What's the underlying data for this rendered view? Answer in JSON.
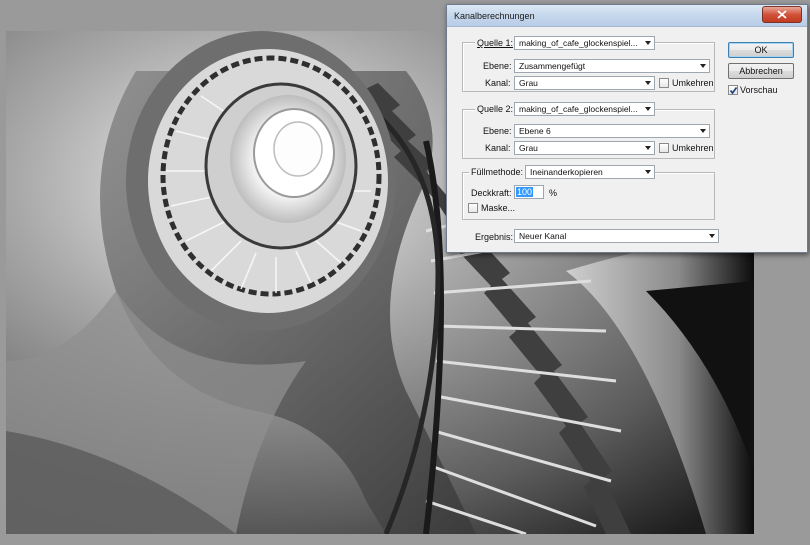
{
  "dialog": {
    "title": "Kanalberechnungen",
    "source1": {
      "label": "Quelle 1:",
      "file": "making_of_cafe_glockenspiel...",
      "layer_label": "Ebene:",
      "layer": "Zusammengefügt",
      "channel_label": "Kanal:",
      "channel": "Grau",
      "invert_label": "Umkehren",
      "invert_checked": false
    },
    "source2": {
      "label": "Quelle 2:",
      "file": "making_of_cafe_glockenspiel...",
      "layer_label": "Ebene:",
      "layer": "Ebene 6",
      "channel_label": "Kanal:",
      "channel": "Grau",
      "invert_label": "Umkehren",
      "invert_checked": false
    },
    "blending": {
      "mode_label": "Füllmethode:",
      "mode": "Ineinanderkopieren",
      "opacity_label": "Deckkraft:",
      "opacity_value": "100",
      "opacity_unit": "%",
      "mask_label": "Maske...",
      "mask_checked": false
    },
    "result": {
      "label": "Ergebnis:",
      "value": "Neuer Kanal"
    },
    "buttons": {
      "ok": "OK",
      "cancel": "Abbrechen"
    },
    "preview": {
      "label": "Vorschau",
      "checked": true
    }
  },
  "colors": {
    "workspace": "#9a9a9a",
    "dialog_bg": "#f0f0f0",
    "titlebar": "#c4d6ec",
    "close_button": "#c23a22",
    "selection": "#3399ff"
  }
}
